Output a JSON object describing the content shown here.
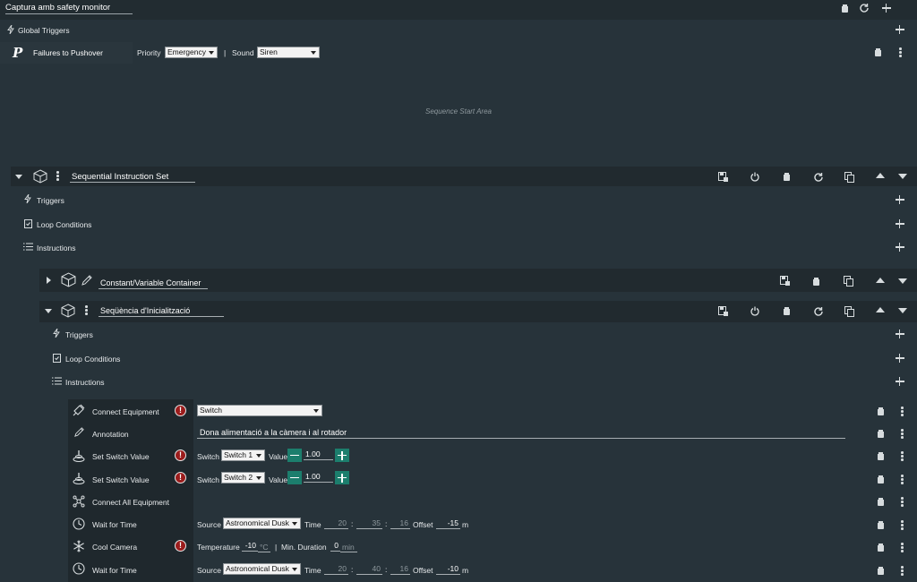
{
  "sequence": {
    "title": "Captura amb safety monitor"
  },
  "global_triggers": {
    "label": "Global Triggers",
    "item": {
      "name": "Failures to Pushover",
      "priority_label": "Priority",
      "priority": "Emergency",
      "separator": "|",
      "sound_label": "Sound",
      "sound": "Siren"
    }
  },
  "start_area": {
    "label": "Sequence Start Area"
  },
  "sis": {
    "title": "Sequential Instruction Set",
    "triggers": "Triggers",
    "loop": "Loop Conditions",
    "instructions": "Instructions"
  },
  "container": {
    "title": "Constant/Variable Container"
  },
  "init": {
    "title": "Seqüència d'Inicialització",
    "triggers": "Triggers",
    "loop": "Loop Conditions",
    "instructions": "Instructions",
    "items": {
      "connect": {
        "name": "Connect Equipment",
        "value": "Switch"
      },
      "annotation": {
        "name": "Annotation",
        "text": "Dona alimentació a la càmera i al rotador"
      },
      "ssv1": {
        "name": "Set Switch Value",
        "switch_label": "Switch",
        "switch": "Switch 1",
        "value_label": "Value",
        "value": "1.00"
      },
      "ssv2": {
        "name": "Set Switch Value",
        "switch_label": "Switch",
        "switch": "Switch 2",
        "value_label": "Value",
        "value": "1.00"
      },
      "connect_all": {
        "name": "Connect All Equipment"
      },
      "wait1": {
        "name": "Wait for Time",
        "source_label": "Source",
        "source": "Astronomical Dusk",
        "time_label": "Time",
        "h": "20",
        "m": "35",
        "s": "16",
        "offset_label": "Offset",
        "offset": "-15",
        "unit": "m",
        "colon": ":"
      },
      "cool": {
        "name": "Cool Camera",
        "temp_label": "Temperature",
        "temp": "-10",
        "temp_unit": "°C",
        "sep": "|",
        "min_label": "Min. Duration",
        "min": "0",
        "min_unit": "min"
      },
      "wait2": {
        "name": "Wait for Time",
        "source_label": "Source",
        "source": "Astronomical Dusk",
        "time_label": "Time",
        "h": "20",
        "m": "40",
        "s": "16",
        "offset_label": "Offset",
        "offset": "-10",
        "unit": "m",
        "colon": ":"
      }
    }
  }
}
